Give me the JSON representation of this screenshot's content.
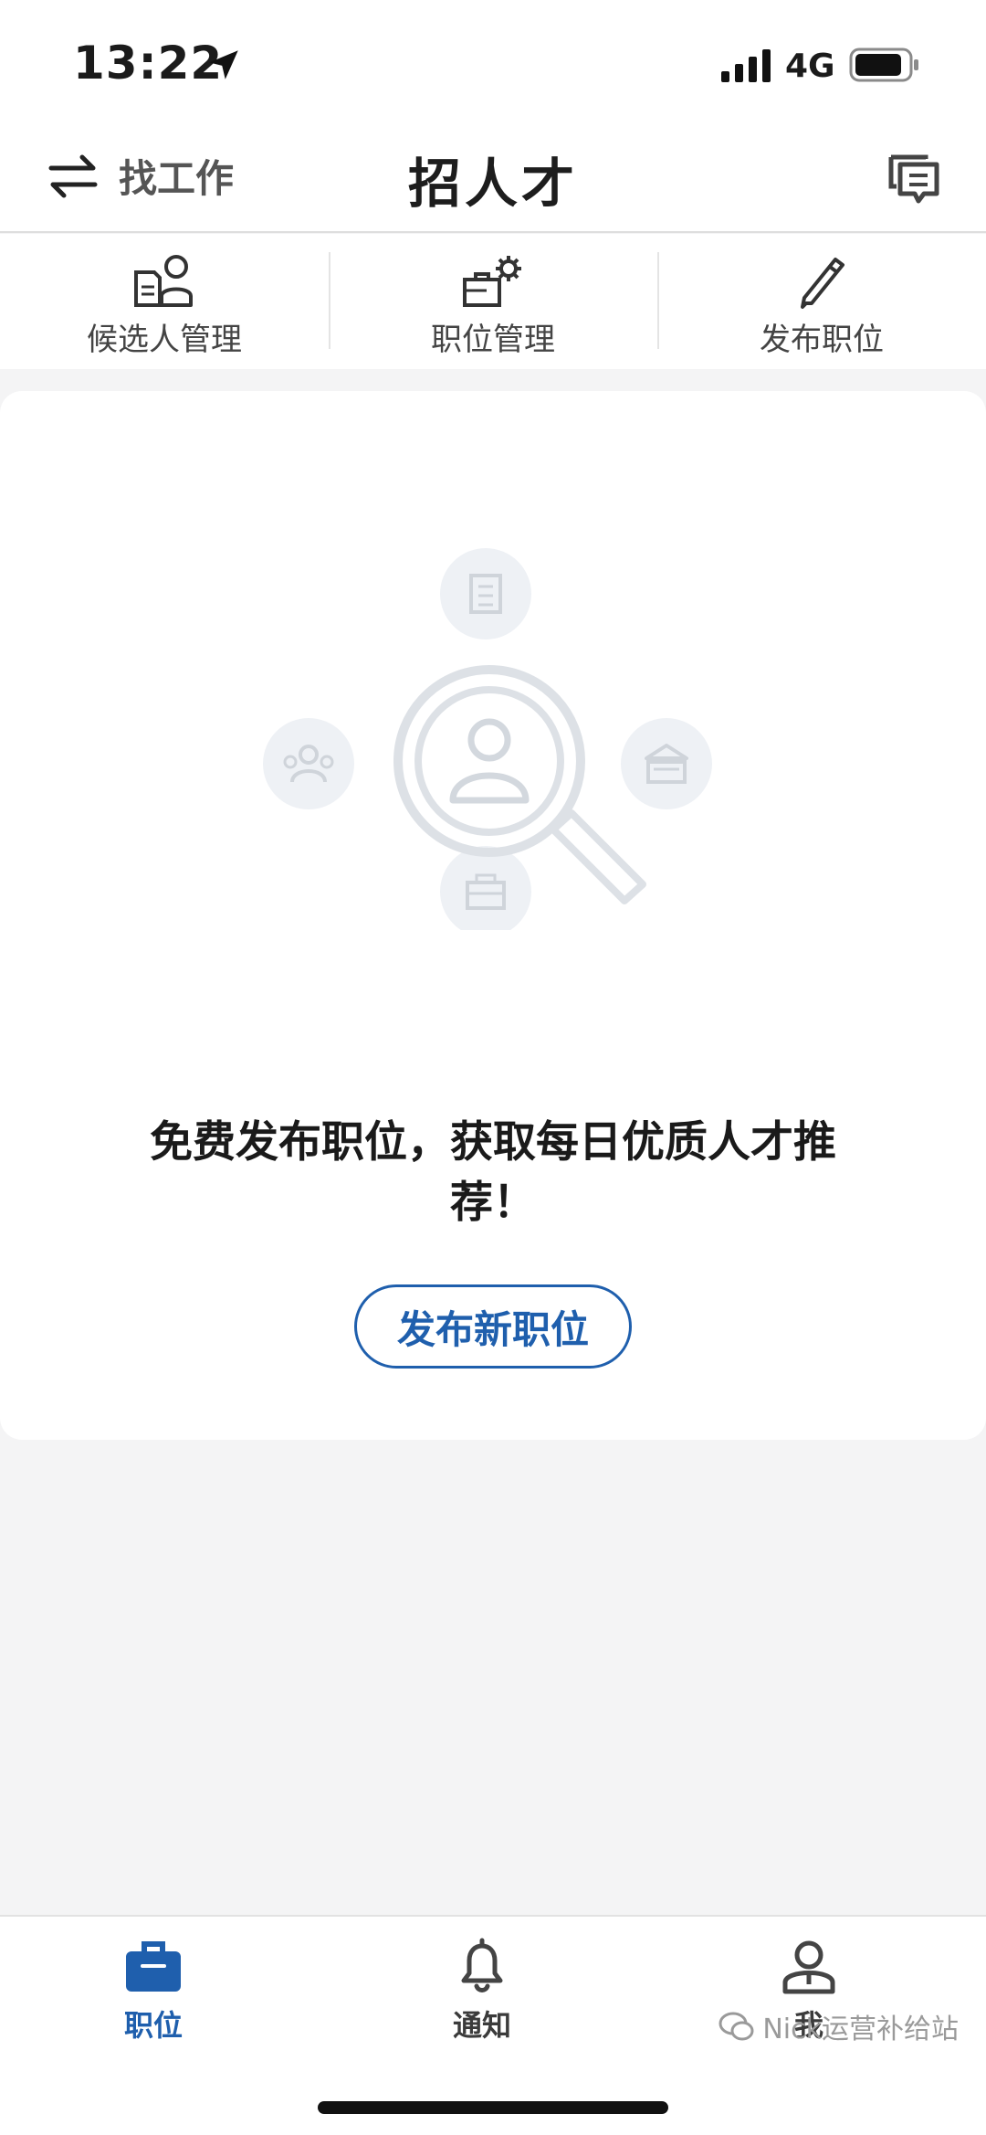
{
  "status_bar": {
    "time": "13:22",
    "network": "4G",
    "icons": [
      "location-arrow-icon",
      "signal-icon",
      "battery-icon"
    ]
  },
  "header": {
    "switch_label": "找工作",
    "switch_icon": "swap-arrows-icon",
    "title": "招人才",
    "message_icon": "chat-icon"
  },
  "toolbar": {
    "items": [
      {
        "label": "候选人管理",
        "icon": "candidate-icon"
      },
      {
        "label": "职位管理",
        "icon": "job-settings-icon"
      },
      {
        "label": "发布职位",
        "icon": "pencil-icon"
      }
    ]
  },
  "main": {
    "illustration_icons": [
      "magnifier-icon",
      "document-icon",
      "group-icon",
      "building-icon",
      "briefcase-icon"
    ],
    "message": "免费发布职位，获取每日优质人才推荐！",
    "publish_button": "发布新职位"
  },
  "tabbar": {
    "tabs": [
      {
        "label": "职位",
        "icon": "briefcase-icon",
        "active": true
      },
      {
        "label": "通知",
        "icon": "bell-icon",
        "active": false
      },
      {
        "label": "我",
        "icon": "user-icon",
        "active": false
      }
    ]
  },
  "watermark": "Nick运营补给站",
  "colors": {
    "accent": "#1f5fad",
    "background": "#f4f4f5",
    "card": "#ffffff",
    "illustration": "#e6e9ee"
  }
}
